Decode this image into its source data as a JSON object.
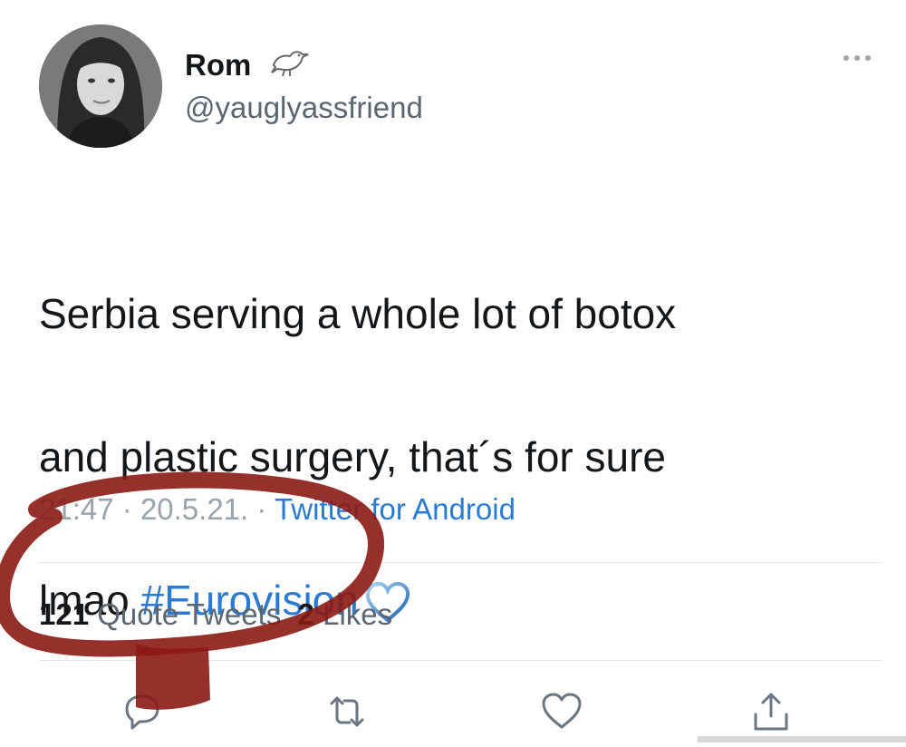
{
  "tweet": {
    "display_name": "Rom",
    "handle": "@yauglyassfriend",
    "text_line1": "Serbia serving a whole lot of botox",
    "text_line2": "and plastic surgery, that´s for sure",
    "text_line3_prefix": "lmao ",
    "hashtag": "#Eurovision",
    "time": "21:47",
    "date": "20.5.21.",
    "separator": "·",
    "source": "Twitter for Android",
    "quote_tweets_count": "121",
    "quote_tweets_label": "Quote Tweets",
    "likes_count": "2",
    "likes_label": "Likes"
  },
  "icons": {
    "header": [
      "avatar",
      "bird-emoji-icon",
      "more-options-icon"
    ],
    "text": [
      "heart-emoji-icon"
    ],
    "actions": [
      "reply-icon",
      "retweet-icon",
      "like-icon",
      "share-icon"
    ]
  },
  "colors": {
    "text": "#14171a",
    "secondary": "#5b6670",
    "link": "#2b7bd2",
    "annotation": "#8b1a14"
  }
}
